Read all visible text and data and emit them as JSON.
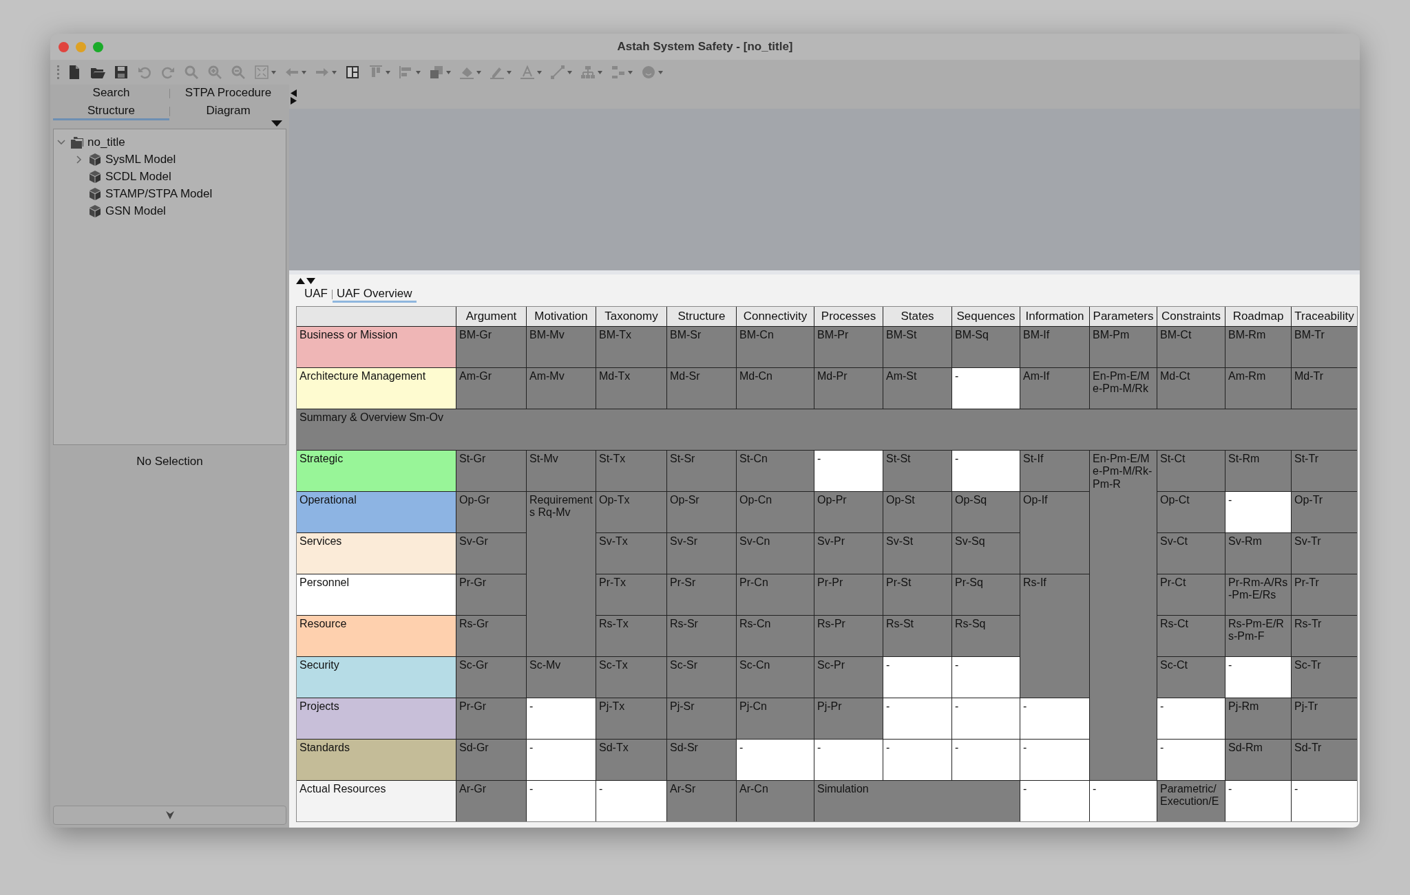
{
  "window": {
    "title": "Astah System Safety - [no_title]"
  },
  "left_tabs": [
    {
      "label": "Search",
      "selected": false
    },
    {
      "label": "STPA Procedure",
      "selected": false
    },
    {
      "label": "Structure",
      "selected": true
    },
    {
      "label": "Diagram",
      "selected": false
    }
  ],
  "tree": [
    {
      "label": "no_title",
      "kind": "project",
      "expanded": true,
      "children": [
        {
          "label": "SysML Model",
          "kind": "model",
          "expanded": false
        },
        {
          "label": "SCDL Model",
          "kind": "model"
        },
        {
          "label": "STAMP/STPA Model",
          "kind": "model"
        },
        {
          "label": "GSN Model",
          "kind": "model"
        }
      ]
    }
  ],
  "property_panel": {
    "message": "No Selection"
  },
  "bottom_tabs": [
    {
      "label": "UAF",
      "selected": false
    },
    {
      "label": "UAF Overview",
      "selected": true
    }
  ],
  "table": {
    "columns": [
      "Argument",
      "Motivation",
      "Taxonomy",
      "Structure",
      "Connectivity",
      "Processes",
      "States",
      "Sequences",
      "Information",
      "Parameters",
      "Constraints",
      "Roadmap",
      "Traceability"
    ],
    "rows": [
      {
        "kind": "domain",
        "label": "Business or Mission",
        "color": "#efb6b6",
        "cells": [
          {
            "text": "BM-Gr",
            "shaded": true
          },
          {
            "text": "BM-Mv",
            "shaded": true
          },
          {
            "text": "BM-Tx",
            "shaded": true
          },
          {
            "text": "BM-Sr",
            "shaded": true
          },
          {
            "text": "BM-Cn",
            "shaded": true
          },
          {
            "text": "BM-Pr",
            "shaded": true
          },
          {
            "text": "BM-St",
            "shaded": true
          },
          {
            "text": "BM-Sq",
            "shaded": true
          },
          {
            "text": "BM-If",
            "shaded": true
          },
          {
            "text": "BM-Pm",
            "shaded": true
          },
          {
            "text": "BM-Ct",
            "shaded": true
          },
          {
            "text": "BM-Rm",
            "shaded": true
          },
          {
            "text": "BM-Tr",
            "shaded": true
          }
        ]
      },
      {
        "kind": "domain",
        "label": "Architecture Management",
        "color": "#fefbd0",
        "cells": [
          {
            "text": "Am-Gr",
            "shaded": true
          },
          {
            "text": "Am-Mv",
            "shaded": true
          },
          {
            "text": "Md-Tx",
            "shaded": true
          },
          {
            "text": "Md-Sr",
            "shaded": true
          },
          {
            "text": "Md-Cn",
            "shaded": true
          },
          {
            "text": "Md-Pr",
            "shaded": true
          },
          {
            "text": "Am-St",
            "shaded": true
          },
          {
            "text": "-",
            "shaded": false
          },
          {
            "text": "Am-If",
            "shaded": true
          },
          {
            "text": "En-Pm-E/Me-Pm-M/Rk",
            "shaded": true
          },
          {
            "text": "Md-Ct",
            "shaded": true
          },
          {
            "text": "Am-Rm",
            "shaded": true
          },
          {
            "text": "Md-Tr",
            "shaded": true
          }
        ]
      },
      {
        "kind": "summary",
        "label": "Summary & Overview Sm-Ov",
        "cells": []
      },
      {
        "kind": "domain",
        "label": "Strategic",
        "color": "#98f598",
        "cells": [
          {
            "text": "St-Gr",
            "shaded": true
          },
          {
            "text": "St-Mv",
            "shaded": true
          },
          {
            "text": "St-Tx",
            "shaded": true
          },
          {
            "text": "St-Sr",
            "shaded": true
          },
          {
            "text": "St-Cn",
            "shaded": true
          },
          {
            "text": "-",
            "shaded": false
          },
          {
            "text": "St-St",
            "shaded": true
          },
          {
            "text": "-",
            "shaded": false
          },
          {
            "text": "St-If",
            "shaded": true
          },
          {
            "text": "En-Pm-E/Me-Pm-M/Rk-Pm-R",
            "shaded": true,
            "rowspan": 8
          },
          {
            "text": "St-Ct",
            "shaded": true
          },
          {
            "text": "St-Rm",
            "shaded": true
          },
          {
            "text": "St-Tr",
            "shaded": true
          }
        ]
      },
      {
        "kind": "domain",
        "label": "Operational",
        "color": "#8db4e3",
        "cells": [
          {
            "text": "Op-Gr",
            "shaded": true
          },
          {
            "text": "Requirements Rq-Mv",
            "shaded": true,
            "rowspan": 4
          },
          {
            "text": "Op-Tx",
            "shaded": true
          },
          {
            "text": "Op-Sr",
            "shaded": true
          },
          {
            "text": "Op-Cn",
            "shaded": true
          },
          {
            "text": "Op-Pr",
            "shaded": true
          },
          {
            "text": "Op-St",
            "shaded": true
          },
          {
            "text": "Op-Sq",
            "shaded": true
          },
          {
            "text": "Op-If",
            "shaded": true,
            "rowspan": 2
          },
          {
            "text": "Op-Ct",
            "shaded": true
          },
          {
            "text": "-",
            "shaded": false
          },
          {
            "text": "Op-Tr",
            "shaded": true
          }
        ]
      },
      {
        "kind": "domain",
        "label": "Services",
        "color": "#fbebd8",
        "cells": [
          {
            "text": "Sv-Gr",
            "shaded": true
          },
          {
            "text": "Sv-Tx",
            "shaded": true
          },
          {
            "text": "Sv-Sr",
            "shaded": true
          },
          {
            "text": "Sv-Cn",
            "shaded": true
          },
          {
            "text": "Sv-Pr",
            "shaded": true
          },
          {
            "text": "Sv-St",
            "shaded": true
          },
          {
            "text": "Sv-Sq",
            "shaded": true
          },
          {
            "text": "Sv-Ct",
            "shaded": true
          },
          {
            "text": "Sv-Rm",
            "shaded": true
          },
          {
            "text": "Sv-Tr",
            "shaded": true
          }
        ]
      },
      {
        "kind": "domain",
        "label": "Personnel",
        "color": "#ffffff",
        "cells": [
          {
            "text": "Pr-Gr",
            "shaded": true
          },
          {
            "text": "Pr-Tx",
            "shaded": true
          },
          {
            "text": "Pr-Sr",
            "shaded": true
          },
          {
            "text": "Pr-Cn",
            "shaded": true
          },
          {
            "text": "Pr-Pr",
            "shaded": true
          },
          {
            "text": "Pr-St",
            "shaded": true
          },
          {
            "text": "Pr-Sq",
            "shaded": true
          },
          {
            "text": "Rs-If",
            "shaded": true,
            "rowspan": 3
          },
          {
            "text": "Pr-Ct",
            "shaded": true
          },
          {
            "text": "Pr-Rm-A/Rs-Pm-E/Rs",
            "shaded": true
          },
          {
            "text": "Pr-Tr",
            "shaded": true
          }
        ]
      },
      {
        "kind": "domain",
        "label": "Resource",
        "color": "#fed0ae",
        "cells": [
          {
            "text": "Rs-Gr",
            "shaded": true
          },
          {
            "text": "Rs-Tx",
            "shaded": true
          },
          {
            "text": "Rs-Sr",
            "shaded": true
          },
          {
            "text": "Rs-Cn",
            "shaded": true
          },
          {
            "text": "Rs-Pr",
            "shaded": true
          },
          {
            "text": "Rs-St",
            "shaded": true
          },
          {
            "text": "Rs-Sq",
            "shaded": true
          },
          {
            "text": "Rs-Ct",
            "shaded": true
          },
          {
            "text": "Rs-Pm-E/Rs-Pm-F",
            "shaded": true
          },
          {
            "text": "Rs-Tr",
            "shaded": true
          }
        ]
      },
      {
        "kind": "domain",
        "label": "Security",
        "color": "#b6dce6",
        "cells": [
          {
            "text": "Sc-Gr",
            "shaded": true
          },
          {
            "text": "Sc-Mv",
            "shaded": true
          },
          {
            "text": "Sc-Tx",
            "shaded": true
          },
          {
            "text": "Sc-Sr",
            "shaded": true
          },
          {
            "text": "Sc-Cn",
            "shaded": true
          },
          {
            "text": "Sc-Pr",
            "shaded": true
          },
          {
            "text": "-",
            "shaded": false
          },
          {
            "text": "-",
            "shaded": false
          },
          {
            "text": "Sc-Ct",
            "shaded": true
          },
          {
            "text": "-",
            "shaded": false
          },
          {
            "text": "Sc-Tr",
            "shaded": true
          }
        ]
      },
      {
        "kind": "domain",
        "label": "Projects",
        "color": "#c8bfd9",
        "cells": [
          {
            "text": "Pr-Gr",
            "shaded": true
          },
          {
            "text": "-",
            "shaded": false
          },
          {
            "text": "Pj-Tx",
            "shaded": true
          },
          {
            "text": "Pj-Sr",
            "shaded": true
          },
          {
            "text": "Pj-Cn",
            "shaded": true
          },
          {
            "text": "Pj-Pr",
            "shaded": true
          },
          {
            "text": "-",
            "shaded": false
          },
          {
            "text": "-",
            "shaded": false
          },
          {
            "text": "-",
            "shaded": false
          },
          {
            "text": "-",
            "shaded": false
          },
          {
            "text": "Pj-Rm",
            "shaded": true
          },
          {
            "text": "Pj-Tr",
            "shaded": true
          }
        ]
      },
      {
        "kind": "domain",
        "label": "Standards",
        "color": "#c4bc98",
        "cells": [
          {
            "text": "Sd-Gr",
            "shaded": true
          },
          {
            "text": "-",
            "shaded": false
          },
          {
            "text": "Sd-Tx",
            "shaded": true
          },
          {
            "text": "Sd-Sr",
            "shaded": true
          },
          {
            "text": "-",
            "shaded": false
          },
          {
            "text": "-",
            "shaded": false
          },
          {
            "text": "-",
            "shaded": false
          },
          {
            "text": "-",
            "shaded": false
          },
          {
            "text": "-",
            "shaded": false
          },
          {
            "text": "-",
            "shaded": false
          },
          {
            "text": "Sd-Rm",
            "shaded": true
          },
          {
            "text": "Sd-Tr",
            "shaded": true
          }
        ]
      },
      {
        "kind": "domain",
        "label": "Actual Resources",
        "color": "#f3f3f3",
        "cells": [
          {
            "text": "Ar-Gr",
            "shaded": true
          },
          {
            "text": "-",
            "shaded": false
          },
          {
            "text": "-",
            "shaded": false
          },
          {
            "text": "Ar-Sr",
            "shaded": true
          },
          {
            "text": "Ar-Cn",
            "shaded": true
          },
          {
            "text": "Simulation",
            "shaded": true,
            "colspan": 3
          },
          {
            "text": "-",
            "shaded": false
          },
          {
            "text": "-",
            "shaded": false
          },
          {
            "text": "Parametric/Execution/E",
            "shaded": true
          },
          {
            "text": "-",
            "shaded": false
          },
          {
            "text": "-",
            "shaded": false
          }
        ]
      }
    ]
  }
}
